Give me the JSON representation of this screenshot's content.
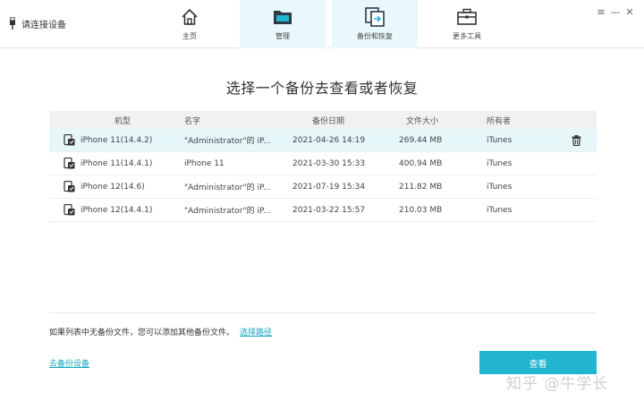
{
  "header": {
    "device_label": "请连接设备",
    "tabs": [
      {
        "label": "主页",
        "icon": "home-icon",
        "active": false
      },
      {
        "label": "管理",
        "icon": "folder-icon",
        "active": true
      },
      {
        "label": "备份和恢复",
        "icon": "backup-restore-icon",
        "active": true
      },
      {
        "label": "更多工具",
        "icon": "toolbox-icon",
        "active": false
      }
    ],
    "window_controls": [
      "≡",
      "—",
      "✕"
    ]
  },
  "main": {
    "title": "选择一个备份去查看或者恢复",
    "columns": [
      "机型",
      "名字",
      "备份日期",
      "文件大小",
      "所有者"
    ],
    "rows": [
      {
        "model": "iPhone 11(14.4.2)",
        "name": "\"Administrator\"的 iP...",
        "date": "2021-04-26 14:19",
        "size": "269.44 MB",
        "owner": "iTunes",
        "selected": true
      },
      {
        "model": "iPhone 11(14.4.1)",
        "name": "iPhone 11",
        "date": "2021-03-30 15:33",
        "size": "400.94 MB",
        "owner": "iTunes",
        "selected": false
      },
      {
        "model": "iPhone 12(14.6)",
        "name": "\"Administrator\"的 iP...",
        "date": "2021-07-19 15:34",
        "size": "211.82 MB",
        "owner": "iTunes",
        "selected": false
      },
      {
        "model": "iPhone 12(14.4.1)",
        "name": "\"Administrator\"的 iP...",
        "date": "2021-03-22 15:57",
        "size": "210.03 MB",
        "owner": "iTunes",
        "selected": false
      }
    ],
    "hint_text": "如果列表中无备份文件，您可以添加其他备份文件。",
    "select_path_link": "选择路径",
    "backup_link": "去备份设备",
    "view_button": "查看"
  },
  "watermark": "知乎 @牛学长",
  "colors": {
    "accent": "#21b5d0",
    "tab_active_bg": "#e9f8fa",
    "row_selected_bg": "#e5f7f9"
  }
}
